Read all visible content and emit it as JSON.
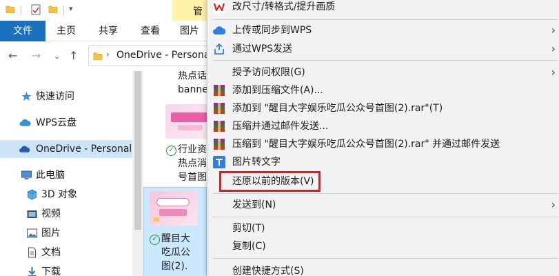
{
  "titlebar": {
    "manage_label": "管"
  },
  "ribbon": {
    "tabs": [
      {
        "label": "文件",
        "active": true
      },
      {
        "label": "主页"
      },
      {
        "label": "共享"
      },
      {
        "label": "查看"
      },
      {
        "label": "图片"
      }
    ]
  },
  "address": {
    "path": "OneDrive - Persona"
  },
  "sidebar": {
    "items": [
      {
        "label": "快速访问",
        "icon": "star-icon"
      },
      {
        "label": "WPS云盘",
        "icon": "cloud-icon"
      },
      {
        "label": "OneDrive - Personal",
        "icon": "onedrive-icon",
        "selected": true
      },
      {
        "label": "此电脑",
        "icon": "computer-icon"
      },
      {
        "label": "3D 对象",
        "icon": "cube-3d-icon"
      },
      {
        "label": "视频",
        "icon": "video-icon"
      },
      {
        "label": "图片",
        "icon": "picture-icon"
      },
      {
        "label": "文档",
        "icon": "document-icon"
      },
      {
        "label": "下载",
        "icon": "download-icon"
      }
    ]
  },
  "files": [
    {
      "lines": [
        "热点话",
        "banne"
      ]
    },
    {
      "lines": [
        "行业资",
        "热点消",
        "号首图"
      ],
      "synced": true
    },
    {
      "lines": [
        "醒目大",
        "吃瓜公",
        "图(2)."
      ],
      "synced": true,
      "selected": true
    }
  ],
  "menu": {
    "items": [
      {
        "label": "改尺寸/转格式/提升画质",
        "icon": "wps-icon"
      },
      {
        "label": "上传或同步到WPS",
        "icon": "wps-cloud-icon",
        "submenu": true
      },
      {
        "label": "通过WPS发送",
        "icon": "share-icon",
        "submenu": true
      },
      {
        "label": "授予访问权限(G)",
        "submenu": true
      },
      {
        "label": "添加到压缩文件(A)...",
        "icon": "winrar-icon"
      },
      {
        "label": "添加到 \"醒目大字娱乐吃瓜公众号首图(2).rar\"(T)",
        "icon": "winrar-icon"
      },
      {
        "label": "压缩并通过邮件发送...",
        "icon": "winrar-icon"
      },
      {
        "label": "压缩到 \"醒目大字娱乐吃瓜公众号首图(2).rar\" 并通过邮件发送",
        "icon": "winrar-icon"
      },
      {
        "label": "图片转文字",
        "icon": "image-to-text-icon"
      },
      {
        "label": "还原以前的版本(V)",
        "highlighted": true
      },
      {
        "label": "发送到(N)",
        "submenu": true
      },
      {
        "label": "剪切(T)"
      },
      {
        "label": "复制(C)"
      },
      {
        "label": "创建快捷方式(S)"
      }
    ]
  },
  "colors": {
    "file_tab": "#1a6fbf",
    "selection": "#cce4f7",
    "highlight_border": "#c0262c",
    "menu_bg": "#f2f2f2"
  }
}
